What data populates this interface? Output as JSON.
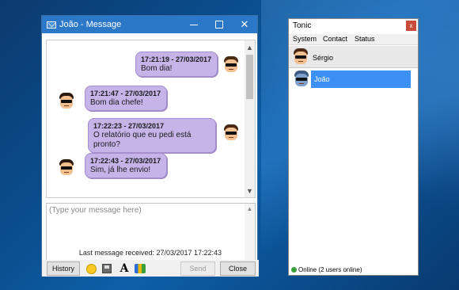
{
  "message_window": {
    "title": "João - Message",
    "messages": [
      {
        "side": "right",
        "timestamp": "17:21:19 - 27/03/2017",
        "text": "Bom dia!"
      },
      {
        "side": "left",
        "timestamp": "17:21:47 - 27/03/2017",
        "text": "Bom dia chefe!"
      },
      {
        "side": "right",
        "timestamp": "17:22:23 - 27/03/2017",
        "text": "O relatório que eu pedi está pronto?"
      },
      {
        "side": "left",
        "timestamp": "17:22:43 - 27/03/2017",
        "text": "Sim, já lhe envio!"
      }
    ],
    "input_placeholder": "(Type your message here)",
    "last_message": "Last message received: 27/03/2017 17:22:43",
    "history_label": "History",
    "send_label": "Send",
    "close_label": "Close"
  },
  "tonic_window": {
    "title": "Tonic",
    "close_label": "x",
    "menu": [
      "System",
      "Contact",
      "Status"
    ],
    "current_user": "Sérgio",
    "contacts": [
      "João"
    ],
    "status_text": "Online  (2 users online)"
  },
  "colors": {
    "titlebar": "#2b77c8",
    "bubble": "#c6b3e8",
    "selection": "#3c8ff5"
  }
}
